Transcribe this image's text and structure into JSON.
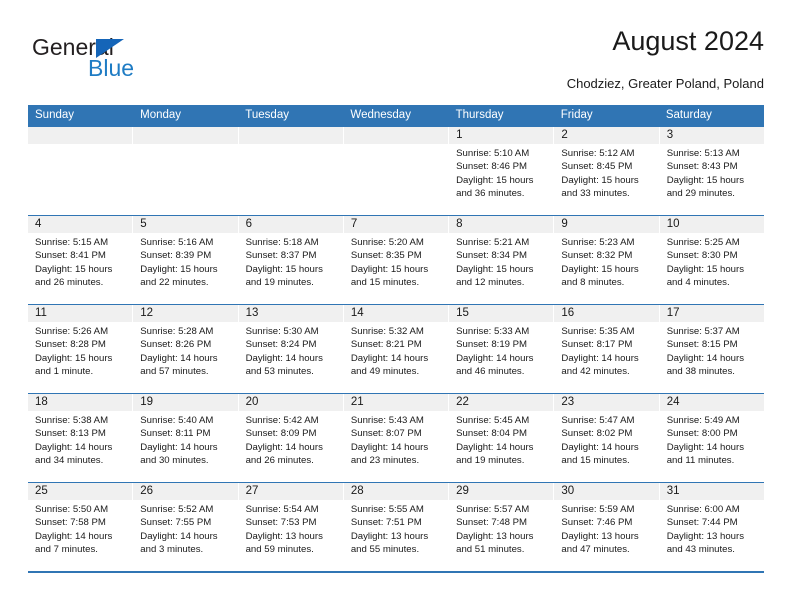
{
  "brand": {
    "name_primary": "General",
    "name_secondary": "Blue",
    "triangle_color": "#1565b8",
    "secondary_color": "#1f7cc4"
  },
  "header": {
    "title": "August 2024",
    "subtitle": "Chodziez, Greater Poland, Poland",
    "accent_color": "#3075b4"
  },
  "calendar": {
    "weekdays": [
      "Sunday",
      "Monday",
      "Tuesday",
      "Wednesday",
      "Thursday",
      "Friday",
      "Saturday"
    ],
    "weeks": [
      [
        {
          "day": "",
          "sunrise": "",
          "sunset": "",
          "daylight_1": "",
          "daylight_2": ""
        },
        {
          "day": "",
          "sunrise": "",
          "sunset": "",
          "daylight_1": "",
          "daylight_2": ""
        },
        {
          "day": "",
          "sunrise": "",
          "sunset": "",
          "daylight_1": "",
          "daylight_2": ""
        },
        {
          "day": "",
          "sunrise": "",
          "sunset": "",
          "daylight_1": "",
          "daylight_2": ""
        },
        {
          "day": "1",
          "sunrise": "Sunrise: 5:10 AM",
          "sunset": "Sunset: 8:46 PM",
          "daylight_1": "Daylight: 15 hours",
          "daylight_2": "and 36 minutes."
        },
        {
          "day": "2",
          "sunrise": "Sunrise: 5:12 AM",
          "sunset": "Sunset: 8:45 PM",
          "daylight_1": "Daylight: 15 hours",
          "daylight_2": "and 33 minutes."
        },
        {
          "day": "3",
          "sunrise": "Sunrise: 5:13 AM",
          "sunset": "Sunset: 8:43 PM",
          "daylight_1": "Daylight: 15 hours",
          "daylight_2": "and 29 minutes."
        }
      ],
      [
        {
          "day": "4",
          "sunrise": "Sunrise: 5:15 AM",
          "sunset": "Sunset: 8:41 PM",
          "daylight_1": "Daylight: 15 hours",
          "daylight_2": "and 26 minutes."
        },
        {
          "day": "5",
          "sunrise": "Sunrise: 5:16 AM",
          "sunset": "Sunset: 8:39 PM",
          "daylight_1": "Daylight: 15 hours",
          "daylight_2": "and 22 minutes."
        },
        {
          "day": "6",
          "sunrise": "Sunrise: 5:18 AM",
          "sunset": "Sunset: 8:37 PM",
          "daylight_1": "Daylight: 15 hours",
          "daylight_2": "and 19 minutes."
        },
        {
          "day": "7",
          "sunrise": "Sunrise: 5:20 AM",
          "sunset": "Sunset: 8:35 PM",
          "daylight_1": "Daylight: 15 hours",
          "daylight_2": "and 15 minutes."
        },
        {
          "day": "8",
          "sunrise": "Sunrise: 5:21 AM",
          "sunset": "Sunset: 8:34 PM",
          "daylight_1": "Daylight: 15 hours",
          "daylight_2": "and 12 minutes."
        },
        {
          "day": "9",
          "sunrise": "Sunrise: 5:23 AM",
          "sunset": "Sunset: 8:32 PM",
          "daylight_1": "Daylight: 15 hours",
          "daylight_2": "and 8 minutes."
        },
        {
          "day": "10",
          "sunrise": "Sunrise: 5:25 AM",
          "sunset": "Sunset: 8:30 PM",
          "daylight_1": "Daylight: 15 hours",
          "daylight_2": "and 4 minutes."
        }
      ],
      [
        {
          "day": "11",
          "sunrise": "Sunrise: 5:26 AM",
          "sunset": "Sunset: 8:28 PM",
          "daylight_1": "Daylight: 15 hours",
          "daylight_2": "and 1 minute."
        },
        {
          "day": "12",
          "sunrise": "Sunrise: 5:28 AM",
          "sunset": "Sunset: 8:26 PM",
          "daylight_1": "Daylight: 14 hours",
          "daylight_2": "and 57 minutes."
        },
        {
          "day": "13",
          "sunrise": "Sunrise: 5:30 AM",
          "sunset": "Sunset: 8:24 PM",
          "daylight_1": "Daylight: 14 hours",
          "daylight_2": "and 53 minutes."
        },
        {
          "day": "14",
          "sunrise": "Sunrise: 5:32 AM",
          "sunset": "Sunset: 8:21 PM",
          "daylight_1": "Daylight: 14 hours",
          "daylight_2": "and 49 minutes."
        },
        {
          "day": "15",
          "sunrise": "Sunrise: 5:33 AM",
          "sunset": "Sunset: 8:19 PM",
          "daylight_1": "Daylight: 14 hours",
          "daylight_2": "and 46 minutes."
        },
        {
          "day": "16",
          "sunrise": "Sunrise: 5:35 AM",
          "sunset": "Sunset: 8:17 PM",
          "daylight_1": "Daylight: 14 hours",
          "daylight_2": "and 42 minutes."
        },
        {
          "day": "17",
          "sunrise": "Sunrise: 5:37 AM",
          "sunset": "Sunset: 8:15 PM",
          "daylight_1": "Daylight: 14 hours",
          "daylight_2": "and 38 minutes."
        }
      ],
      [
        {
          "day": "18",
          "sunrise": "Sunrise: 5:38 AM",
          "sunset": "Sunset: 8:13 PM",
          "daylight_1": "Daylight: 14 hours",
          "daylight_2": "and 34 minutes."
        },
        {
          "day": "19",
          "sunrise": "Sunrise: 5:40 AM",
          "sunset": "Sunset: 8:11 PM",
          "daylight_1": "Daylight: 14 hours",
          "daylight_2": "and 30 minutes."
        },
        {
          "day": "20",
          "sunrise": "Sunrise: 5:42 AM",
          "sunset": "Sunset: 8:09 PM",
          "daylight_1": "Daylight: 14 hours",
          "daylight_2": "and 26 minutes."
        },
        {
          "day": "21",
          "sunrise": "Sunrise: 5:43 AM",
          "sunset": "Sunset: 8:07 PM",
          "daylight_1": "Daylight: 14 hours",
          "daylight_2": "and 23 minutes."
        },
        {
          "day": "22",
          "sunrise": "Sunrise: 5:45 AM",
          "sunset": "Sunset: 8:04 PM",
          "daylight_1": "Daylight: 14 hours",
          "daylight_2": "and 19 minutes."
        },
        {
          "day": "23",
          "sunrise": "Sunrise: 5:47 AM",
          "sunset": "Sunset: 8:02 PM",
          "daylight_1": "Daylight: 14 hours",
          "daylight_2": "and 15 minutes."
        },
        {
          "day": "24",
          "sunrise": "Sunrise: 5:49 AM",
          "sunset": "Sunset: 8:00 PM",
          "daylight_1": "Daylight: 14 hours",
          "daylight_2": "and 11 minutes."
        }
      ],
      [
        {
          "day": "25",
          "sunrise": "Sunrise: 5:50 AM",
          "sunset": "Sunset: 7:58 PM",
          "daylight_1": "Daylight: 14 hours",
          "daylight_2": "and 7 minutes."
        },
        {
          "day": "26",
          "sunrise": "Sunrise: 5:52 AM",
          "sunset": "Sunset: 7:55 PM",
          "daylight_1": "Daylight: 14 hours",
          "daylight_2": "and 3 minutes."
        },
        {
          "day": "27",
          "sunrise": "Sunrise: 5:54 AM",
          "sunset": "Sunset: 7:53 PM",
          "daylight_1": "Daylight: 13 hours",
          "daylight_2": "and 59 minutes."
        },
        {
          "day": "28",
          "sunrise": "Sunrise: 5:55 AM",
          "sunset": "Sunset: 7:51 PM",
          "daylight_1": "Daylight: 13 hours",
          "daylight_2": "and 55 minutes."
        },
        {
          "day": "29",
          "sunrise": "Sunrise: 5:57 AM",
          "sunset": "Sunset: 7:48 PM",
          "daylight_1": "Daylight: 13 hours",
          "daylight_2": "and 51 minutes."
        },
        {
          "day": "30",
          "sunrise": "Sunrise: 5:59 AM",
          "sunset": "Sunset: 7:46 PM",
          "daylight_1": "Daylight: 13 hours",
          "daylight_2": "and 47 minutes."
        },
        {
          "day": "31",
          "sunrise": "Sunrise: 6:00 AM",
          "sunset": "Sunset: 7:44 PM",
          "daylight_1": "Daylight: 13 hours",
          "daylight_2": "and 43 minutes."
        }
      ]
    ]
  }
}
